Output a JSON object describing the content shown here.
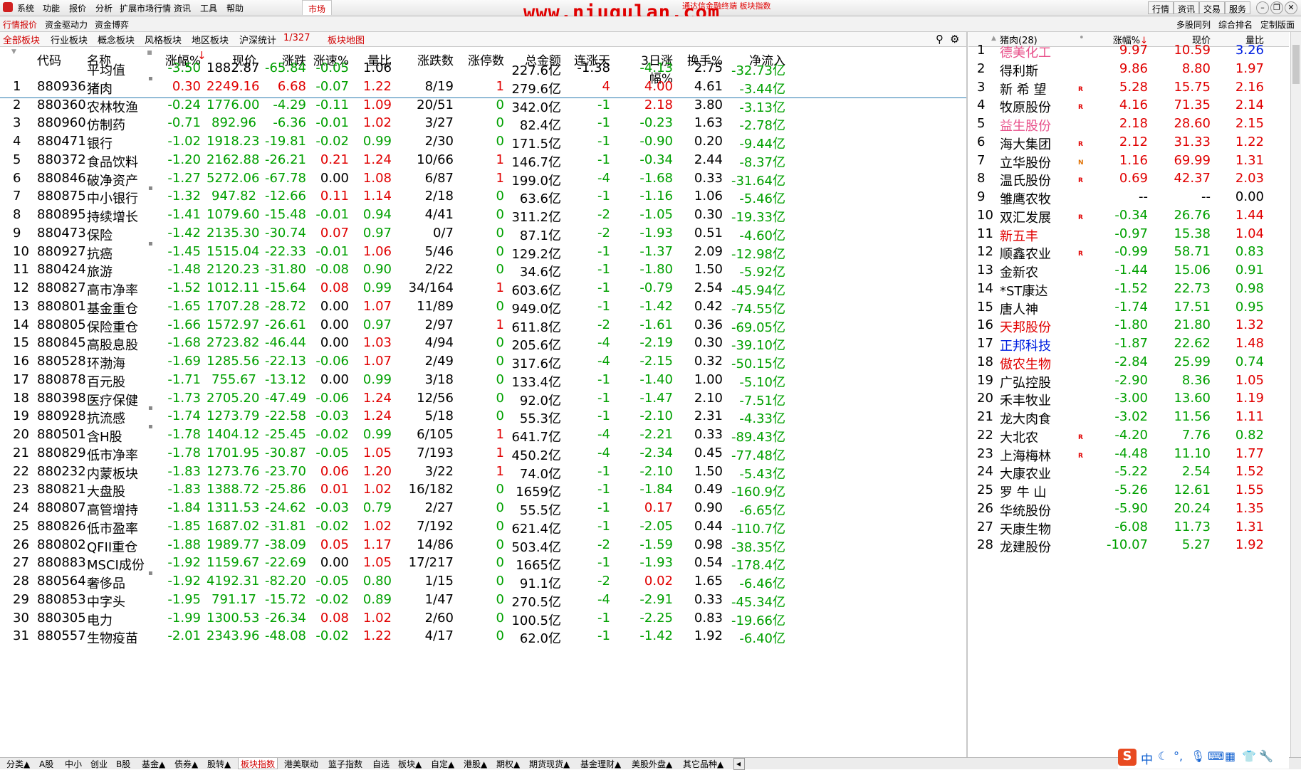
{
  "menu": [
    "系统",
    "功能",
    "报价",
    "分析",
    "扩展市场行情",
    "资讯",
    "工具",
    "帮助"
  ],
  "menu_market": "市场",
  "watermark": "www.niugulan.com",
  "watermark_small": "通达信金融终端  板块指数",
  "right_buttons": [
    "行情",
    "资讯",
    "交易",
    "服务"
  ],
  "bar2_left": [
    "行情报价",
    "资金驱动力",
    "资金博弈"
  ],
  "bar2_right": [
    "多股同列",
    "综合排名",
    "定制版面"
  ],
  "bar3": {
    "tabs": [
      "全部板块",
      "行业板块",
      "概念板块",
      "风格板块",
      "地区板块",
      "沪深统计"
    ],
    "count": "1/327",
    "map": "板块地图"
  },
  "columns": [
    "代码",
    "名称",
    "涨幅%",
    "现价",
    "涨跌",
    "涨速%",
    "量比",
    "涨跌数",
    "涨停数",
    "总金额",
    "连涨天",
    "3日涨幅%",
    "换手%",
    "净流入"
  ],
  "average": {
    "label": "平均值",
    "chg": "-3.50",
    "price": "1882.87",
    "diff": "-65.84",
    "speed": "-0.05",
    "vol": "1.06",
    "amount": "227.6亿",
    "days": "-1.38",
    "chg3": "-4.13",
    "turn": "2.75",
    "flow": "-32.73亿"
  },
  "rows": [
    [
      "1",
      "880936",
      "猪肉",
      "0.30",
      "2249.16",
      "6.68",
      "-0.07",
      "1.22",
      "8/19",
      "1",
      "279.6亿",
      "4",
      "4.00",
      "4.61",
      "-3.44亿"
    ],
    [
      "2",
      "880360",
      "农林牧渔",
      "-0.24",
      "1776.00",
      "-4.29",
      "-0.11",
      "1.09",
      "20/51",
      "0",
      "342.0亿",
      "-1",
      "2.18",
      "3.80",
      "-3.13亿"
    ],
    [
      "3",
      "880960",
      "仿制药",
      "-0.71",
      "892.96",
      "-6.36",
      "-0.01",
      "1.02",
      "3/27",
      "0",
      "82.4亿",
      "-1",
      "-0.23",
      "1.63",
      "-2.78亿"
    ],
    [
      "4",
      "880471",
      "银行",
      "-1.02",
      "1918.23",
      "-19.81",
      "-0.02",
      "0.99",
      "2/30",
      "0",
      "171.5亿",
      "-1",
      "-0.90",
      "0.20",
      "-9.44亿"
    ],
    [
      "5",
      "880372",
      "食品饮料",
      "-1.20",
      "2162.88",
      "-26.21",
      "0.21",
      "1.24",
      "10/66",
      "1",
      "146.7亿",
      "-1",
      "-0.34",
      "2.44",
      "-8.37亿"
    ],
    [
      "6",
      "880846",
      "破净资产",
      "-1.27",
      "5272.06",
      "-67.78",
      "0.00",
      "1.08",
      "6/87",
      "1",
      "199.0亿",
      "-4",
      "-1.68",
      "0.33",
      "-31.64亿"
    ],
    [
      "7",
      "880875",
      "中小银行",
      "-1.32",
      "947.82",
      "-12.66",
      "0.11",
      "1.14",
      "2/18",
      "0",
      "63.6亿",
      "-1",
      "-1.16",
      "1.06",
      "-5.46亿"
    ],
    [
      "8",
      "880895",
      "持续增长",
      "-1.41",
      "1079.60",
      "-15.48",
      "-0.01",
      "0.94",
      "4/41",
      "0",
      "311.2亿",
      "-2",
      "-1.05",
      "0.30",
      "-19.33亿"
    ],
    [
      "9",
      "880473",
      "保险",
      "-1.42",
      "2135.30",
      "-30.74",
      "0.07",
      "0.97",
      "0/7",
      "0",
      "87.1亿",
      "-2",
      "-1.93",
      "0.51",
      "-4.60亿"
    ],
    [
      "10",
      "880927",
      "抗癌",
      "-1.45",
      "1515.04",
      "-22.33",
      "-0.01",
      "1.06",
      "5/46",
      "0",
      "129.2亿",
      "-1",
      "-1.37",
      "2.09",
      "-12.98亿"
    ],
    [
      "11",
      "880424",
      "旅游",
      "-1.48",
      "2120.23",
      "-31.80",
      "-0.08",
      "0.90",
      "2/22",
      "0",
      "34.6亿",
      "-1",
      "-1.80",
      "1.50",
      "-5.92亿"
    ],
    [
      "12",
      "880827",
      "高市净率",
      "-1.52",
      "1012.11",
      "-15.64",
      "0.08",
      "0.99",
      "34/164",
      "1",
      "603.6亿",
      "-1",
      "-0.79",
      "2.54",
      "-45.94亿"
    ],
    [
      "13",
      "880801",
      "基金重仓",
      "-1.65",
      "1707.28",
      "-28.72",
      "0.00",
      "1.07",
      "11/89",
      "0",
      "949.0亿",
      "-1",
      "-1.42",
      "0.42",
      "-74.55亿"
    ],
    [
      "14",
      "880805",
      "保险重仓",
      "-1.66",
      "1572.97",
      "-26.61",
      "0.00",
      "0.97",
      "2/97",
      "1",
      "611.8亿",
      "-2",
      "-1.61",
      "0.36",
      "-69.05亿"
    ],
    [
      "15",
      "880845",
      "高股息股",
      "-1.68",
      "2723.82",
      "-46.44",
      "0.00",
      "1.03",
      "4/94",
      "0",
      "205.6亿",
      "-4",
      "-2.19",
      "0.30",
      "-39.10亿"
    ],
    [
      "16",
      "880528",
      "环渤海",
      "-1.69",
      "1285.56",
      "-22.13",
      "-0.06",
      "1.07",
      "2/49",
      "0",
      "317.6亿",
      "-4",
      "-2.15",
      "0.32",
      "-50.15亿"
    ],
    [
      "17",
      "880878",
      "百元股",
      "-1.71",
      "755.67",
      "-13.12",
      "0.00",
      "0.99",
      "3/18",
      "0",
      "133.4亿",
      "-1",
      "-1.40",
      "1.00",
      "-5.10亿"
    ],
    [
      "18",
      "880398",
      "医疗保健",
      "-1.73",
      "2705.20",
      "-47.49",
      "-0.06",
      "1.24",
      "12/56",
      "0",
      "92.0亿",
      "-1",
      "-1.47",
      "2.10",
      "-7.51亿"
    ],
    [
      "19",
      "880928",
      "抗流感",
      "-1.74",
      "1273.79",
      "-22.58",
      "-0.03",
      "1.24",
      "5/18",
      "0",
      "55.3亿",
      "-1",
      "-2.10",
      "2.31",
      "-4.33亿"
    ],
    [
      "20",
      "880501",
      "含H股",
      "-1.78",
      "1404.12",
      "-25.45",
      "-0.02",
      "0.99",
      "6/105",
      "1",
      "641.7亿",
      "-4",
      "-2.21",
      "0.33",
      "-89.43亿"
    ],
    [
      "21",
      "880829",
      "低市净率",
      "-1.78",
      "1701.95",
      "-30.87",
      "-0.05",
      "1.05",
      "7/193",
      "1",
      "450.2亿",
      "-4",
      "-2.34",
      "0.45",
      "-77.48亿"
    ],
    [
      "22",
      "880232",
      "内蒙板块",
      "-1.83",
      "1273.76",
      "-23.70",
      "0.06",
      "1.20",
      "3/22",
      "1",
      "74.0亿",
      "-1",
      "-2.10",
      "1.50",
      "-5.43亿"
    ],
    [
      "23",
      "880821",
      "大盘股",
      "-1.83",
      "1388.72",
      "-25.86",
      "0.01",
      "1.02",
      "16/182",
      "0",
      "1659亿",
      "-1",
      "-1.84",
      "0.49",
      "-160.9亿"
    ],
    [
      "24",
      "880807",
      "高管增持",
      "-1.84",
      "1311.53",
      "-24.62",
      "-0.03",
      "0.79",
      "2/27",
      "0",
      "55.5亿",
      "-1",
      "0.17",
      "0.90",
      "-6.65亿"
    ],
    [
      "25",
      "880826",
      "低市盈率",
      "-1.85",
      "1687.02",
      "-31.81",
      "-0.02",
      "1.02",
      "7/192",
      "0",
      "621.4亿",
      "-1",
      "-2.05",
      "0.44",
      "-110.7亿"
    ],
    [
      "26",
      "880802",
      "QFII重仓",
      "-1.88",
      "1989.77",
      "-38.09",
      "0.05",
      "1.17",
      "14/86",
      "0",
      "503.4亿",
      "-2",
      "-1.59",
      "0.98",
      "-38.35亿"
    ],
    [
      "27",
      "880883",
      "MSCI成份",
      "-1.92",
      "1159.67",
      "-22.69",
      "0.00",
      "1.05",
      "17/217",
      "0",
      "1665亿",
      "-1",
      "-1.93",
      "0.54",
      "-178.4亿"
    ],
    [
      "28",
      "880564",
      "奢侈品",
      "-1.92",
      "4192.31",
      "-82.20",
      "-0.05",
      "0.80",
      "1/15",
      "0",
      "91.1亿",
      "-2",
      "0.02",
      "1.65",
      "-6.46亿"
    ],
    [
      "29",
      "880853",
      "中字头",
      "-1.95",
      "791.17",
      "-15.72",
      "-0.02",
      "0.89",
      "1/47",
      "0",
      "270.5亿",
      "-4",
      "-2.91",
      "0.33",
      "-45.34亿"
    ],
    [
      "30",
      "880305",
      "电力",
      "-1.99",
      "1300.53",
      "-26.34",
      "0.08",
      "1.02",
      "2/60",
      "0",
      "100.5亿",
      "-1",
      "-2.25",
      "0.83",
      "-19.66亿"
    ],
    [
      "31",
      "880557",
      "生物疫苗",
      "-2.01",
      "2343.96",
      "-48.08",
      "-0.02",
      "1.22",
      "4/17",
      "0",
      "62.0亿",
      "-1",
      "-1.42",
      "1.92",
      "-6.40亿"
    ]
  ],
  "right": {
    "title": "猪肉(28)",
    "columns": [
      "涨幅%",
      "现价",
      "量比"
    ],
    "rows": [
      [
        "1",
        "德美化工",
        "",
        "9.97",
        "10.59",
        "3.26",
        "pink"
      ],
      [
        "2",
        "得利斯",
        "",
        "9.86",
        "8.80",
        "1.97",
        "black"
      ],
      [
        "3",
        "新 希 望",
        "R",
        "5.28",
        "15.75",
        "2.16",
        "black"
      ],
      [
        "4",
        "牧原股份",
        "R",
        "4.16",
        "71.35",
        "2.14",
        "black"
      ],
      [
        "5",
        "益生股份",
        "",
        "2.18",
        "28.60",
        "2.15",
        "pink"
      ],
      [
        "6",
        "海大集团",
        "R",
        "2.12",
        "31.33",
        "1.22",
        "black"
      ],
      [
        "7",
        "立华股份",
        "N",
        "1.16",
        "69.99",
        "1.31",
        "black"
      ],
      [
        "8",
        "温氏股份",
        "R",
        "0.69",
        "42.37",
        "2.03",
        "black"
      ],
      [
        "9",
        "雏鹰农牧",
        "",
        "--",
        "--",
        "0.00",
        "black"
      ],
      [
        "10",
        "双汇发展",
        "R",
        "-0.34",
        "26.76",
        "1.44",
        "black"
      ],
      [
        "11",
        "新五丰",
        "",
        "-0.97",
        "15.38",
        "1.04",
        "red"
      ],
      [
        "12",
        "顺鑫农业",
        "R",
        "-0.99",
        "58.71",
        "0.83",
        "black"
      ],
      [
        "13",
        "金新农",
        "",
        "-1.44",
        "15.06",
        "0.91",
        "black"
      ],
      [
        "14",
        "*ST康达",
        "",
        "-1.52",
        "22.73",
        "0.98",
        "black"
      ],
      [
        "15",
        "唐人神",
        "",
        "-1.74",
        "17.51",
        "0.95",
        "black"
      ],
      [
        "16",
        "天邦股份",
        "",
        "-1.80",
        "21.80",
        "1.32",
        "red"
      ],
      [
        "17",
        "正邦科技",
        "",
        "-1.87",
        "22.62",
        "1.48",
        "blue"
      ],
      [
        "18",
        "傲农生物",
        "",
        "-2.84",
        "25.99",
        "0.74",
        "red"
      ],
      [
        "19",
        "广弘控股",
        "",
        "-2.90",
        "8.36",
        "1.05",
        "black"
      ],
      [
        "20",
        "禾丰牧业",
        "",
        "-3.00",
        "13.60",
        "1.19",
        "black"
      ],
      [
        "21",
        "龙大肉食",
        "",
        "-3.02",
        "11.56",
        "1.11",
        "black"
      ],
      [
        "22",
        "大北农",
        "R",
        "-4.20",
        "7.76",
        "0.82",
        "black"
      ],
      [
        "23",
        "上海梅林",
        "R",
        "-4.48",
        "11.10",
        "1.77",
        "black"
      ],
      [
        "24",
        "大康农业",
        "",
        "-5.22",
        "2.54",
        "1.52",
        "black"
      ],
      [
        "25",
        "罗 牛 山",
        "",
        "-5.26",
        "12.61",
        "1.55",
        "black"
      ],
      [
        "26",
        "华统股份",
        "",
        "-5.90",
        "20.24",
        "1.35",
        "black"
      ],
      [
        "27",
        "天康生物",
        "",
        "-6.08",
        "11.73",
        "1.31",
        "black"
      ],
      [
        "28",
        "龙建股份",
        "",
        "-10.07",
        "5.27",
        "1.92",
        "black"
      ]
    ]
  },
  "bottom_tabs": [
    "分类▲",
    "A股",
    "中小",
    "创业",
    "B股",
    "基金▲",
    "债券▲",
    "股转▲",
    "板块指数",
    "港美联动",
    "篮子指数",
    "自选",
    "板块▲",
    "自定▲",
    "港股▲",
    "期权▲",
    "期货现货▲",
    "基金理财▲",
    "美股外盘▲",
    "其它品种▲"
  ],
  "active_tab": "板块指数",
  "tray": [
    "中"
  ],
  "colors": {
    "up": "#e00000",
    "down": "#00a000",
    "pink": "#e8508a",
    "blue": "#0020e0"
  }
}
